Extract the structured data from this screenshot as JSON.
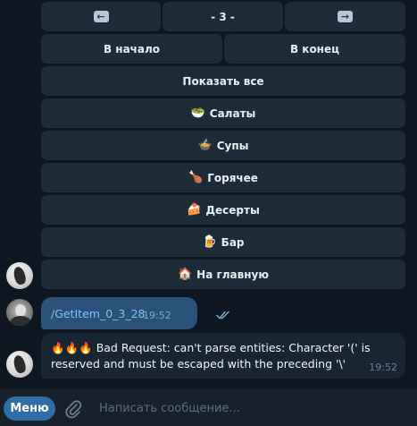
{
  "keyboard": {
    "prev_icon": "left-arrow-icon",
    "page_label": "- 3 -",
    "next_icon": "right-arrow-icon",
    "first_label": "В начало",
    "last_label": "В конец",
    "show_all_label": "Показать все",
    "categories": [
      {
        "emoji": "🥗",
        "label": "Салаты",
        "icon": "salad-icon"
      },
      {
        "emoji": "🍲",
        "label": "Супы",
        "icon": "soup-icon"
      },
      {
        "emoji": "🍗",
        "label": "Горячее",
        "icon": "poultry-leg-icon"
      },
      {
        "emoji": "🍰",
        "label": "Десерты",
        "icon": "cake-icon"
      },
      {
        "emoji": "🍺",
        "label": "Бар",
        "icon": "beer-icon"
      },
      {
        "emoji": "🏠",
        "label": "На главную",
        "icon": "house-icon"
      }
    ]
  },
  "messages": {
    "outgoing": {
      "text": "/GetItem_0_3_28",
      "time": "19:52",
      "status_icon": "double-check-icon"
    },
    "incoming": {
      "emoji": "🔥🔥🔥",
      "text": "Bad Request: can't parse entities: Character '(' is reserved and must be escaped with the preceding '\\'",
      "time": "19:52"
    }
  },
  "composer": {
    "menu_label": "Меню",
    "placeholder": "Написать сообщение...",
    "attach_icon": "paperclip-icon"
  },
  "colors": {
    "background": "#0e1621",
    "keyboard_button": "#1e2c3a",
    "outgoing_bubble": "#2b5278",
    "incoming_bubble": "#182533",
    "menu_button": "#2f6ea5",
    "link": "#7bc4ff"
  }
}
